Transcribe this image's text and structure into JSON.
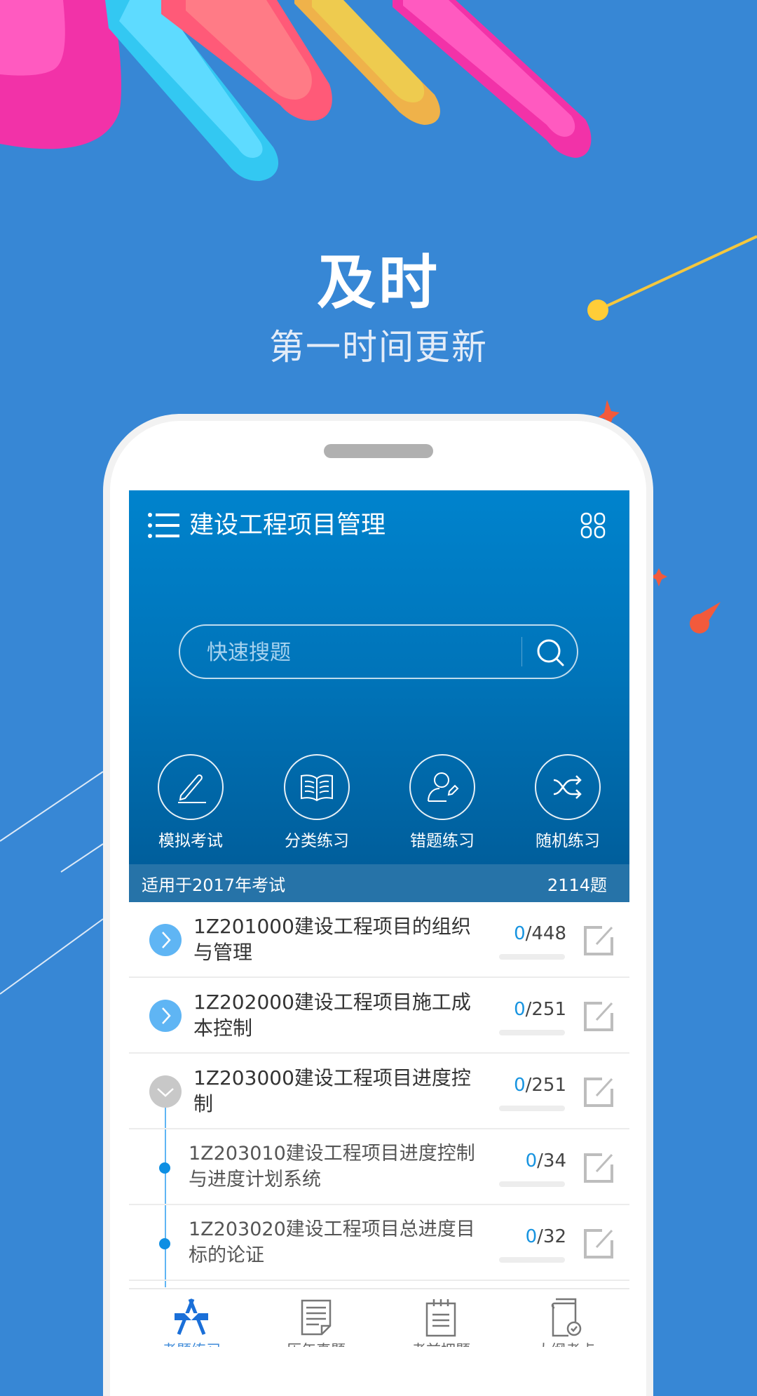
{
  "promo": {
    "title": "及时",
    "subtitle": "第一时间更新"
  },
  "colors": {
    "background": "#3787d5",
    "header_top": "#0083cd",
    "header_bottom": "#005a96",
    "accent_blue": "#1894e0",
    "expander_open": "#5fb5f4",
    "expander_closed": "#c8c8c8",
    "nav_active": "#3f8bd9"
  },
  "app": {
    "title": "建设工程项目管理",
    "menu_icon": "list-menu-icon",
    "grid_icon": "grid-four-icon",
    "search": {
      "placeholder": "快速搜题",
      "value": "",
      "icon": "search-icon"
    },
    "quick_actions": [
      {
        "label": "模拟考试",
        "icon": "pen-icon"
      },
      {
        "label": "分类练习",
        "icon": "open-book-icon"
      },
      {
        "label": "错题练习",
        "icon": "user-edit-icon"
      },
      {
        "label": "随机练习",
        "icon": "shuffle-icon"
      }
    ],
    "info_bar": {
      "applicable": "适用于2017年考试",
      "total": "2114题"
    },
    "chapters": [
      {
        "title": "1Z201000建设工程项目的组织与管理",
        "done": "0",
        "total": "/448",
        "progress": 0,
        "state": "collapsed",
        "level": 1
      },
      {
        "title": "1Z202000建设工程项目施工成本控制",
        "done": "0",
        "total": "/251",
        "progress": 0,
        "state": "collapsed",
        "level": 1
      },
      {
        "title": "1Z203000建设工程项目进度控制",
        "done": "0",
        "total": "/251",
        "progress": 0,
        "state": "expanded",
        "level": 1
      },
      {
        "title": "1Z203010建设工程项目进度控制与进度计划系统",
        "done": "0",
        "total": "/34",
        "progress": 0,
        "level": 2
      },
      {
        "title": "1Z203020建设工程项目总进度目标的论证",
        "done": "0",
        "total": "/32",
        "progress": 0,
        "level": 2
      }
    ],
    "bottom_nav": [
      {
        "label": "考题练习",
        "icon": "compass-ruler-icon",
        "active": true
      },
      {
        "label": "历年真题",
        "icon": "document-icon",
        "active": false
      },
      {
        "label": "考前押题",
        "icon": "notepad-icon",
        "active": false
      },
      {
        "label": "大纲考点",
        "icon": "book-check-icon",
        "active": false
      }
    ]
  }
}
